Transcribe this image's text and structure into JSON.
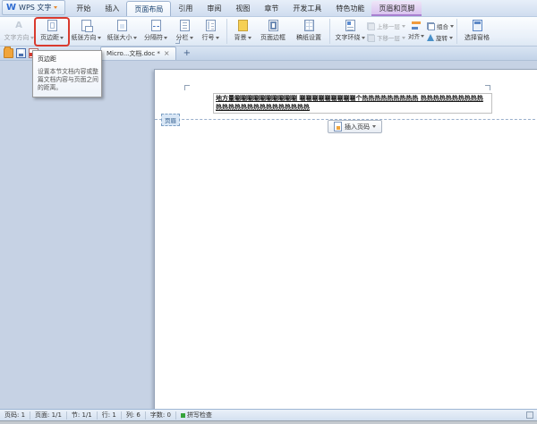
{
  "glyphs": {
    "wps_logo": "W",
    "text_direction_icon": "A",
    "tab_close": "×",
    "new_tab": "+"
  },
  "accent_colors": {
    "highlight_red": "#d93a2e",
    "contextual_tab_purple": "#a77fd0",
    "spellcheck_green": "#35a33b"
  },
  "titlebar": {
    "app_button_label": "WPS 文字",
    "tabs": [
      {
        "label": "开始"
      },
      {
        "label": "插入"
      },
      {
        "label": "页面布局",
        "active": true
      },
      {
        "label": "引用"
      },
      {
        "label": "审阅"
      },
      {
        "label": "视图"
      },
      {
        "label": "章节"
      },
      {
        "label": "开发工具"
      },
      {
        "label": "特色功能"
      },
      {
        "label": "页眉和页脚",
        "contextual": true
      }
    ]
  },
  "ribbon": {
    "buttons": [
      {
        "label": "文字方向",
        "caret": true,
        "disabled": true
      },
      {
        "label": "页边距",
        "caret": true,
        "highlighted": true
      },
      {
        "label": "纸张方向",
        "caret": true
      },
      {
        "label": "纸张大小",
        "caret": true
      },
      {
        "label": "分隔符",
        "caret": true
      },
      {
        "label": "分栏",
        "caret": true
      },
      {
        "label": "行号",
        "caret": true
      },
      {
        "label": "背景",
        "caret": true
      },
      {
        "label": "页面边框"
      },
      {
        "label": "稿纸设置"
      },
      {
        "label": "文字环绕",
        "caret": true
      },
      {
        "label": "上移一层",
        "caret": true,
        "disabled": true
      },
      {
        "label": "下移一层",
        "caret": true,
        "disabled": true
      },
      {
        "label": "对齐",
        "caret": true
      },
      {
        "label": "组合",
        "caret": true
      },
      {
        "label": "旋转",
        "caret": true
      },
      {
        "label": "选择窗格"
      }
    ]
  },
  "tabbar": {
    "doc_tab_label": "Micro...文档.doc *"
  },
  "tooltip": {
    "title": "页边距",
    "line1": "设置本节文档内容或整",
    "line2": "篇文档内容与页面之间",
    "line3": "的距离。"
  },
  "document": {
    "header_tag": "页眉",
    "header_line1": "地方量唰唰唰唰唰唰唰唰唰唰 唰唰唰唰唰唰唰唰唰个热热热热热热热热热 热热热热热热热热热热",
    "header_line2": "热热热热热热热热热热热热热热热",
    "insert_page_number_label": "插入页码"
  },
  "statusbar": {
    "items": [
      {
        "label": "页码: 1"
      },
      {
        "label": "页面: 1/1"
      },
      {
        "label": "节: 1/1"
      },
      {
        "label": "行: 1"
      },
      {
        "label": "列: 6"
      },
      {
        "label": "字数: 0"
      },
      {
        "label": "拼写检查",
        "dot": true
      }
    ]
  }
}
